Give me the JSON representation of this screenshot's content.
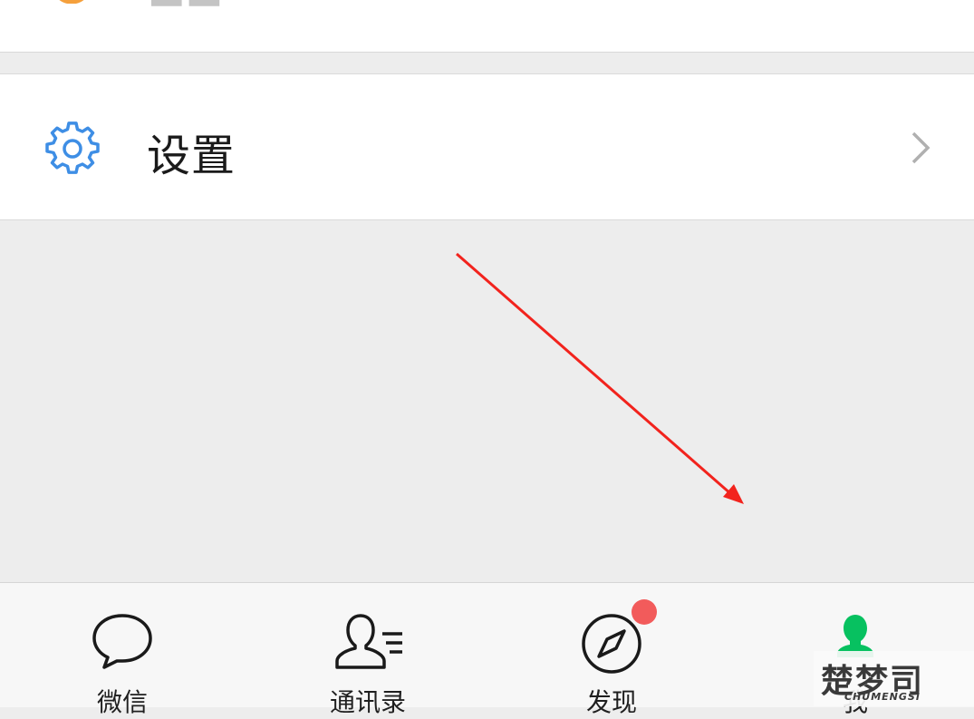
{
  "settings": {
    "label": "设置"
  },
  "tabbar": {
    "tabs": [
      {
        "label": "微信",
        "icon": "chat-bubble-icon"
      },
      {
        "label": "通讯录",
        "icon": "contacts-icon"
      },
      {
        "label": "发现",
        "icon": "compass-icon",
        "badge": true
      },
      {
        "label": "我",
        "icon": "person-icon",
        "active": true
      }
    ]
  },
  "watermark": {
    "main": "楚梦司",
    "sub": "CHUMENGSI"
  },
  "colors": {
    "settings_icon": "#3e8ee5",
    "active_tab": "#07c160",
    "badge": "#f25b5b",
    "annotation_arrow": "#f2231d",
    "top_icon": "#f5a03c"
  }
}
